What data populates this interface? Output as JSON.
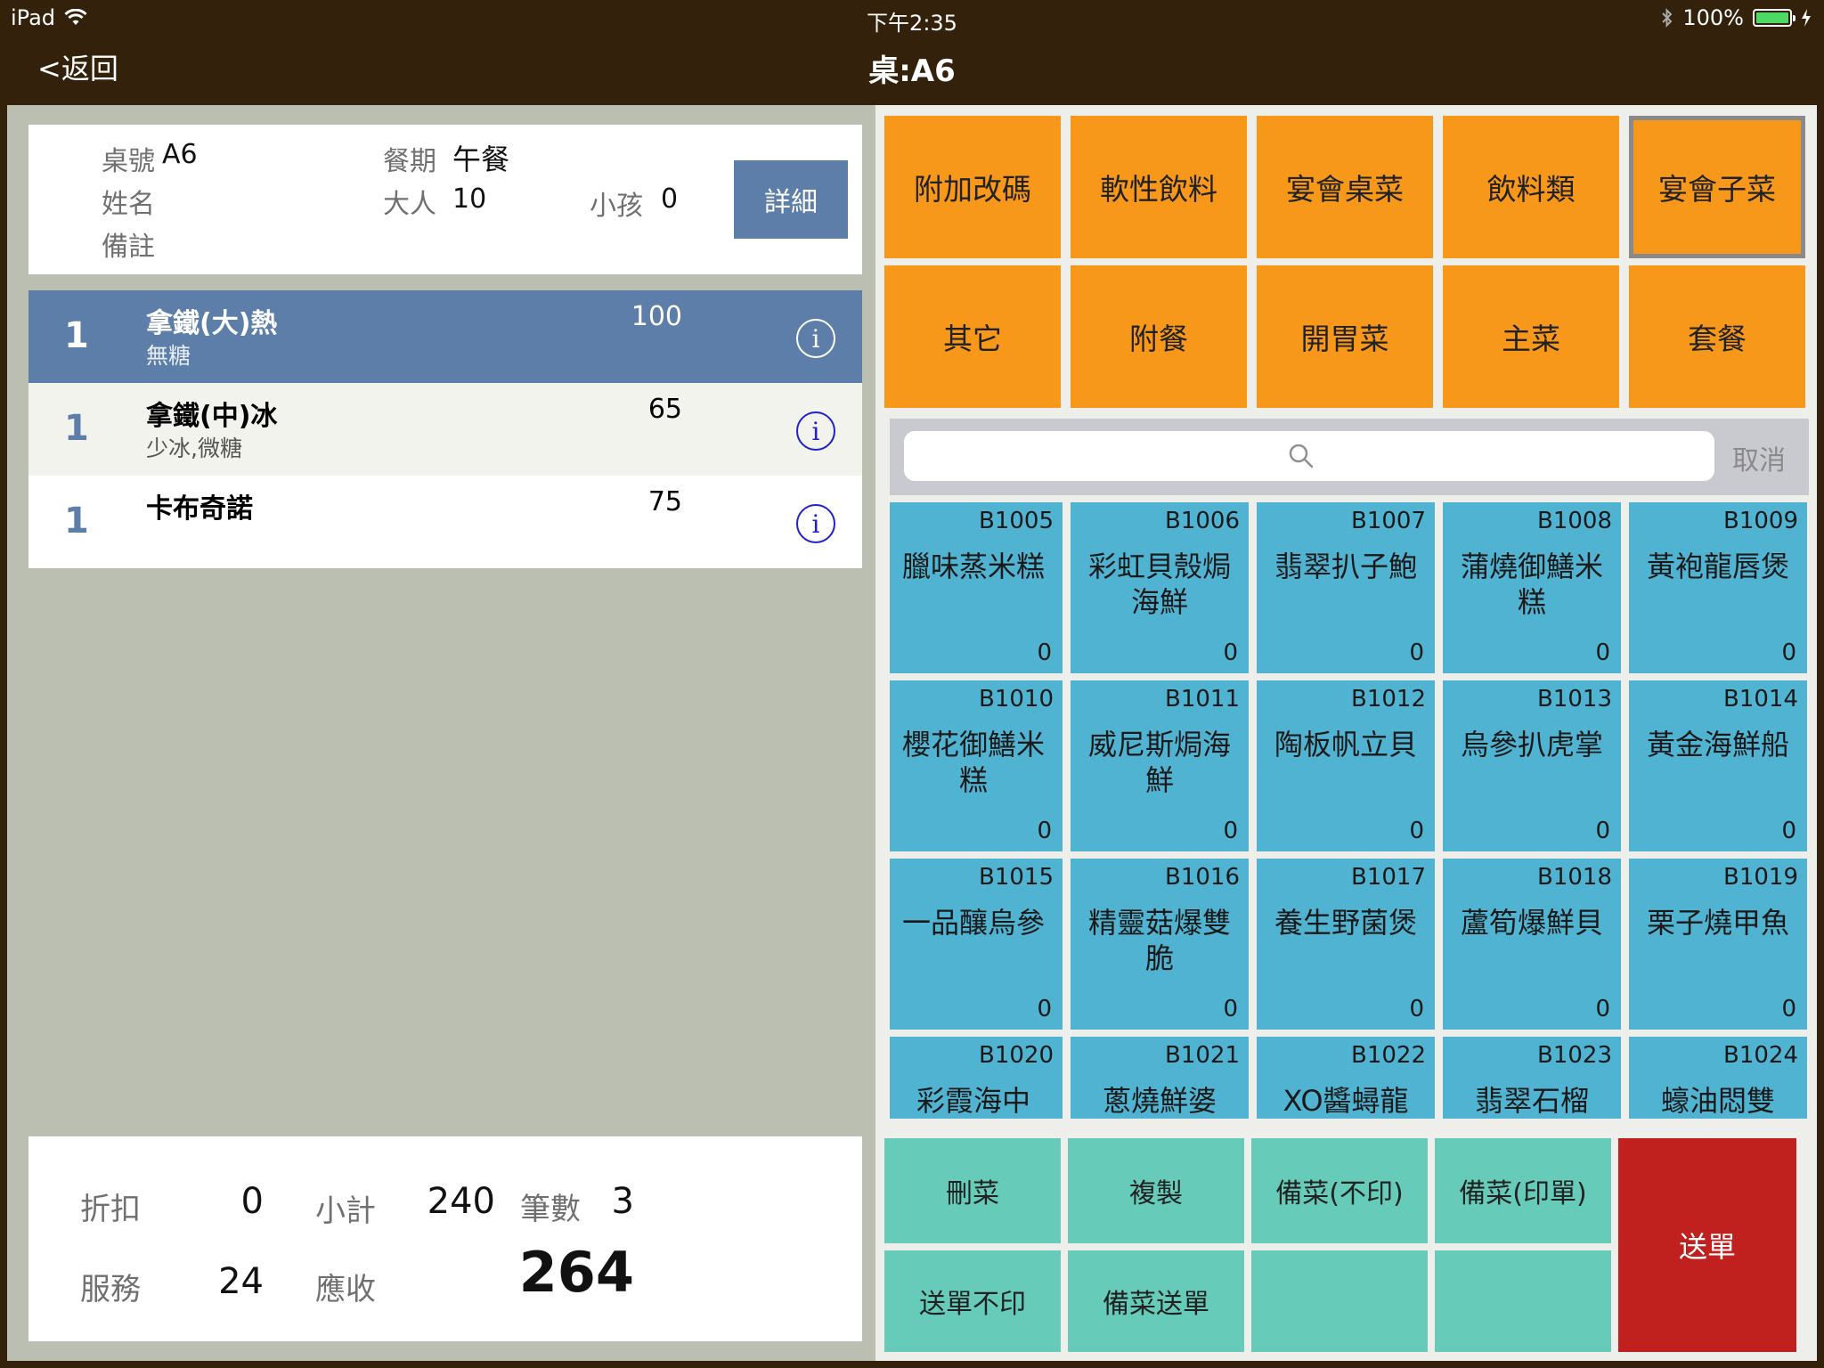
{
  "status": {
    "device": "iPad",
    "time": "下午2:35",
    "battery": "100%",
    "battery_level": 1.0
  },
  "nav": {
    "back": "<返回",
    "title": "桌:A6"
  },
  "info": {
    "table_label": "桌號",
    "table_value": "A6",
    "name_label": "姓名",
    "remark_label": "備註",
    "meal_label": "餐期",
    "meal_value": "午餐",
    "adult_label": "大人",
    "adult_value": "10",
    "child_label": "小孩",
    "child_value": "0",
    "detail_button": "詳細"
  },
  "orders": [
    {
      "qty": "1",
      "name": "拿鐵(大)熱",
      "note": "無糖",
      "price": "100"
    },
    {
      "qty": "1",
      "name": "拿鐵(中)冰",
      "note": "少冰,微糖",
      "price": "65"
    },
    {
      "qty": "1",
      "name": "卡布奇諾",
      "note": "",
      "price": "75"
    }
  ],
  "summary": {
    "discount_label": "折扣",
    "discount": "0",
    "subtotal_label": "小計",
    "subtotal": "240",
    "count_label": "筆數",
    "count": "3",
    "service_label": "服務",
    "service": "24",
    "receivable_label": "應收",
    "receivable": "264"
  },
  "categories": [
    "附加改碼",
    "軟性飲料",
    "宴會桌菜",
    "飲料類",
    "宴會子菜",
    "其它",
    "附餐",
    "開胃菜",
    "主菜",
    "套餐"
  ],
  "search": {
    "placeholder": "",
    "cancel": "取消"
  },
  "items": [
    {
      "code": "B1005",
      "name": "臘味蒸米糕",
      "count": "0"
    },
    {
      "code": "B1006",
      "name": "彩虹貝殼焗海鮮",
      "count": "0"
    },
    {
      "code": "B1007",
      "name": "翡翠扒子鮑",
      "count": "0"
    },
    {
      "code": "B1008",
      "name": "蒲燒御鱔米糕",
      "count": "0"
    },
    {
      "code": "B1009",
      "name": "黃袍龍唇煲",
      "count": "0"
    },
    {
      "code": "B1010",
      "name": "櫻花御鱔米糕",
      "count": "0"
    },
    {
      "code": "B1011",
      "name": "威尼斯焗海鮮",
      "count": "0"
    },
    {
      "code": "B1012",
      "name": "陶板帆立貝",
      "count": "0"
    },
    {
      "code": "B1013",
      "name": "烏參扒虎掌",
      "count": "0"
    },
    {
      "code": "B1014",
      "name": "黃金海鮮船",
      "count": "0"
    },
    {
      "code": "B1015",
      "name": "一品釀烏參",
      "count": "0"
    },
    {
      "code": "B1016",
      "name": "精靈菇爆雙脆",
      "count": "0"
    },
    {
      "code": "B1017",
      "name": "養生野菌煲",
      "count": "0"
    },
    {
      "code": "B1018",
      "name": "蘆筍爆鮮貝",
      "count": "0"
    },
    {
      "code": "B1019",
      "name": "栗子燒甲魚",
      "count": "0"
    },
    {
      "code": "B1020",
      "name": "彩霞海中",
      "count": ""
    },
    {
      "code": "B1021",
      "name": "蔥燒鮮婆",
      "count": ""
    },
    {
      "code": "B1022",
      "name": "XO醬蟳龍",
      "count": ""
    },
    {
      "code": "B1023",
      "name": "翡翠石榴",
      "count": ""
    },
    {
      "code": "B1024",
      "name": "蠔油悶雙",
      "count": ""
    }
  ],
  "actions": {
    "delete": "刪菜",
    "copy": "複製",
    "prep_noprint": "備菜(不印)",
    "prep_print": "備菜(印單)",
    "send_noprint": "送單不印",
    "prep_send": "備菜送單",
    "send": "送單"
  }
}
